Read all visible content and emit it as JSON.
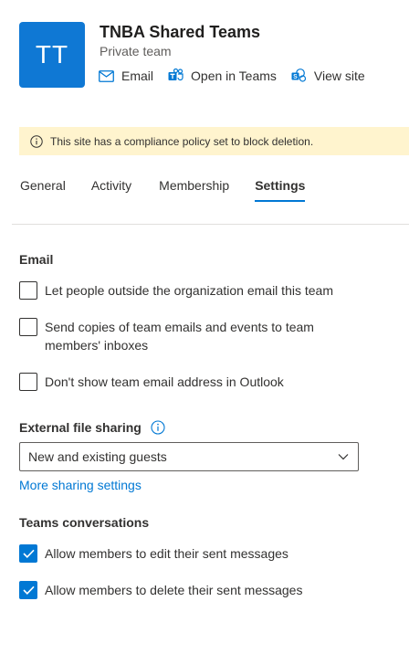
{
  "header": {
    "avatar_initials": "TT",
    "avatar_color": "#0f78d4",
    "title": "TNBA Shared Teams",
    "subtitle": "Private team",
    "actions": [
      {
        "label": "Email",
        "icon": "mail-icon"
      },
      {
        "label": "Open in Teams",
        "icon": "teams-icon"
      },
      {
        "label": "View site",
        "icon": "sharepoint-icon"
      }
    ]
  },
  "banner": {
    "icon": "info-icon",
    "text": "This site has a compliance policy set to block deletion.",
    "background": "#fff4ce"
  },
  "tabs": [
    {
      "label": "General",
      "active": false
    },
    {
      "label": "Activity",
      "active": false
    },
    {
      "label": "Membership",
      "active": false
    },
    {
      "label": "Settings",
      "active": true
    }
  ],
  "email_section": {
    "heading": "Email",
    "options": [
      {
        "label": "Let people outside the organization email this team",
        "checked": false
      },
      {
        "label": "Send copies of team emails and events to team members' inboxes",
        "checked": false
      },
      {
        "label": "Don't show team email address in Outlook",
        "checked": false
      }
    ]
  },
  "sharing_section": {
    "heading": "External file sharing",
    "selected": "New and existing guests",
    "link": "More sharing settings"
  },
  "teams_section": {
    "heading": "Teams conversations",
    "options": [
      {
        "label": "Allow members to edit their sent messages",
        "checked": true
      },
      {
        "label": "Allow members to delete their sent messages",
        "checked": true
      }
    ]
  },
  "accent_color": "#0078d4"
}
